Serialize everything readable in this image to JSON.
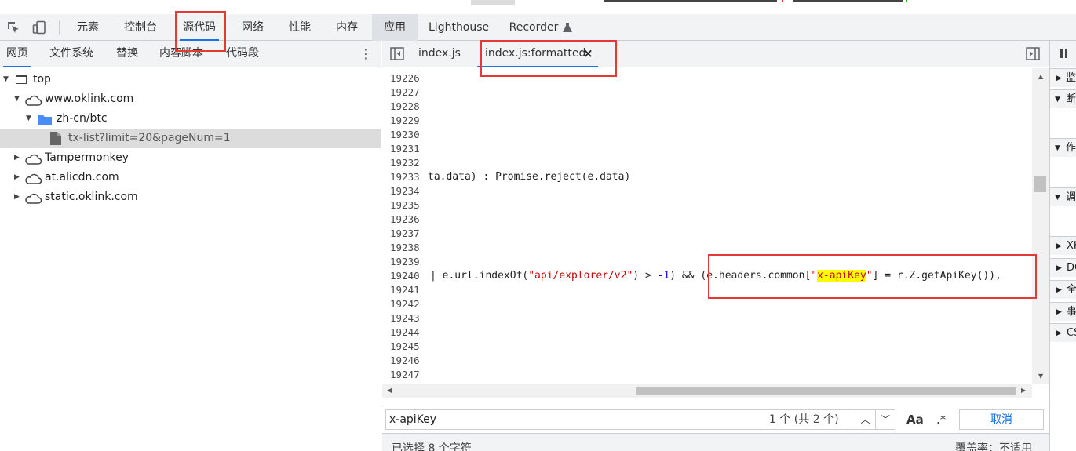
{
  "toolbar": {
    "tabs": [
      "元素",
      "控制台",
      "源代码",
      "网络",
      "性能",
      "内存",
      "应用",
      "Lighthouse",
      "Recorder"
    ]
  },
  "navigator": {
    "tabs": [
      "网页",
      "文件系统",
      "替换",
      "内容脚本",
      "代码段"
    ],
    "tree": [
      {
        "label": "top"
      },
      {
        "label": "www.oklink.com"
      },
      {
        "label": "zh-cn/btc"
      },
      {
        "label": "tx-list?limit=20&pageNum=1"
      },
      {
        "label": "Tampermonkey"
      },
      {
        "label": "at.alicdn.com"
      },
      {
        "label": "static.oklink.com"
      }
    ]
  },
  "editor": {
    "tabs": [
      {
        "label": "index.js"
      },
      {
        "label": "index.js:formatted"
      }
    ],
    "line_numbers": [
      "19226",
      "19227",
      "19228",
      "19229",
      "19230",
      "19231",
      "19232",
      "19233",
      "19234",
      "19235",
      "19236",
      "19237",
      "19238",
      "19239",
      "19240",
      "19241",
      "19242",
      "19243",
      "19244",
      "19245",
      "19246",
      "19247"
    ],
    "code": {
      "l19233_a": "ta.data) : Promise.reject(e.data)",
      "l19240_pipe": "| e.url.indexOf(",
      "l19240_str1": "\"api/explorer/v2\"",
      "l19240_mid": ") > ",
      "l19240_num": "-1",
      "l19240_mid2": ") && (e.headers.common[",
      "l19240_q1": "\"",
      "l19240_hl": "x-apiKey",
      "l19240_q2": "\"",
      "l19240_end": "] = r.Z.getApiKey()),"
    }
  },
  "search": {
    "query": "x-apiKey",
    "match_count": "1 个 (共 2 个)",
    "match_case": "Aa",
    "regex": ".*",
    "cancel": "取消"
  },
  "status": {
    "selection": "已选择 8 个字符",
    "coverage": "覆盖率：不适用"
  },
  "debugger": {
    "sections": [
      "监",
      "断",
      "作",
      "调",
      "XH",
      "DC",
      "全",
      "事",
      "CS"
    ]
  }
}
